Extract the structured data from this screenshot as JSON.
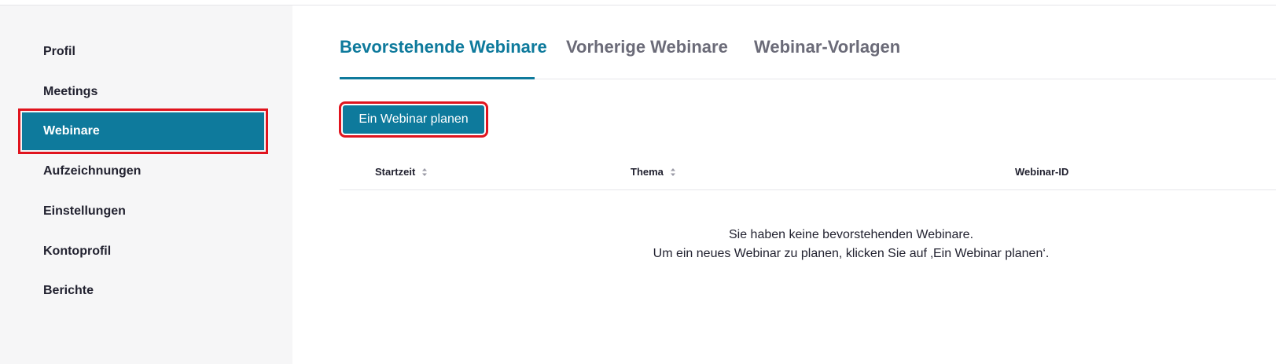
{
  "sidebar": {
    "items": [
      {
        "label": "Profil"
      },
      {
        "label": "Meetings"
      },
      {
        "label": "Webinare",
        "active": true
      },
      {
        "label": "Aufzeichnungen"
      },
      {
        "label": "Einstellungen"
      },
      {
        "label": "Kontoprofil"
      },
      {
        "label": "Berichte"
      }
    ]
  },
  "tabs": [
    {
      "label": "Bevorstehende Webinare",
      "active": true
    },
    {
      "label": "Vorherige Webinare"
    },
    {
      "label": "Webinar-Vorlagen"
    }
  ],
  "toolbar": {
    "schedule_label": "Ein Webinar planen"
  },
  "table": {
    "columns": [
      {
        "label": "Startzeit",
        "sortable": true
      },
      {
        "label": "Thema",
        "sortable": true
      },
      {
        "label": "Webinar-ID",
        "sortable": false
      }
    ]
  },
  "empty_state": {
    "line1": "Sie haben keine bevorstehenden Webinare.",
    "line2": "Um ein neues Webinar zu planen, klicken Sie auf ‚Ein Webinar planen‘."
  },
  "colors": {
    "accent": "#0e7a9c",
    "highlight": "#e0141e",
    "sidebar_bg": "#f6f6f7"
  }
}
